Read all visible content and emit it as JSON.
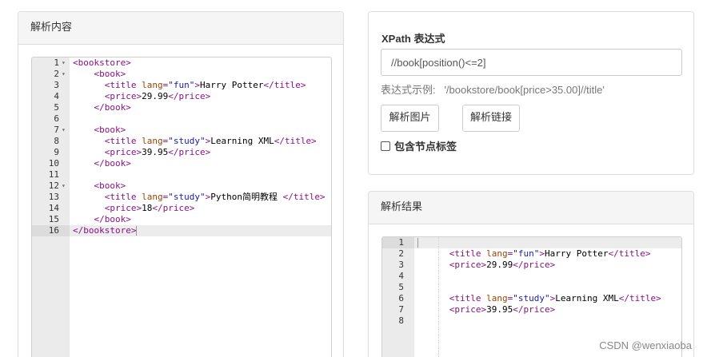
{
  "left_panel": {
    "heading": "解析内容",
    "editor": {
      "active_line": 16,
      "lines": [
        {
          "num": "1",
          "fold": true,
          "parts": [
            [
              "t-tag",
              "<bookstore>"
            ]
          ]
        },
        {
          "num": "2",
          "fold": true,
          "parts": [
            [
              "t-text",
              "    "
            ],
            [
              "t-tag",
              "<book>"
            ]
          ]
        },
        {
          "num": "3",
          "fold": false,
          "parts": [
            [
              "t-text",
              "      "
            ],
            [
              "t-tag",
              "<title "
            ],
            [
              "t-attr",
              "lang"
            ],
            [
              "t-tag",
              "="
            ],
            [
              "t-val",
              "\"fun\""
            ],
            [
              "t-tag",
              ">"
            ],
            [
              "t-text",
              "Harry Potter"
            ],
            [
              "t-tag",
              "</title>"
            ]
          ]
        },
        {
          "num": "4",
          "fold": false,
          "parts": [
            [
              "t-text",
              "      "
            ],
            [
              "t-tag",
              "<price>"
            ],
            [
              "t-text",
              "29.99"
            ],
            [
              "t-tag",
              "</price>"
            ]
          ]
        },
        {
          "num": "5",
          "fold": false,
          "parts": [
            [
              "t-text",
              "    "
            ],
            [
              "t-tag",
              "</book>"
            ]
          ]
        },
        {
          "num": "6",
          "fold": false,
          "parts": []
        },
        {
          "num": "7",
          "fold": true,
          "parts": [
            [
              "t-text",
              "    "
            ],
            [
              "t-tag",
              "<book>"
            ]
          ]
        },
        {
          "num": "8",
          "fold": false,
          "parts": [
            [
              "t-text",
              "      "
            ],
            [
              "t-tag",
              "<title "
            ],
            [
              "t-attr",
              "lang"
            ],
            [
              "t-tag",
              "="
            ],
            [
              "t-val",
              "\"study\""
            ],
            [
              "t-tag",
              ">"
            ],
            [
              "t-text",
              "Learning XML"
            ],
            [
              "t-tag",
              "</title>"
            ]
          ]
        },
        {
          "num": "9",
          "fold": false,
          "parts": [
            [
              "t-text",
              "      "
            ],
            [
              "t-tag",
              "<price>"
            ],
            [
              "t-text",
              "39.95"
            ],
            [
              "t-tag",
              "</price>"
            ]
          ]
        },
        {
          "num": "10",
          "fold": false,
          "parts": [
            [
              "t-text",
              "    "
            ],
            [
              "t-tag",
              "</book>"
            ]
          ]
        },
        {
          "num": "11",
          "fold": false,
          "parts": []
        },
        {
          "num": "12",
          "fold": true,
          "parts": [
            [
              "t-text",
              "    "
            ],
            [
              "t-tag",
              "<book>"
            ]
          ]
        },
        {
          "num": "13",
          "fold": false,
          "parts": [
            [
              "t-text",
              "      "
            ],
            [
              "t-tag",
              "<title "
            ],
            [
              "t-attr",
              "lang"
            ],
            [
              "t-tag",
              "="
            ],
            [
              "t-val",
              "\"study\""
            ],
            [
              "t-tag",
              ">"
            ],
            [
              "t-text",
              "Python简明教程 "
            ],
            [
              "t-tag",
              "</title>"
            ]
          ]
        },
        {
          "num": "14",
          "fold": false,
          "parts": [
            [
              "t-text",
              "      "
            ],
            [
              "t-tag",
              "<price>"
            ],
            [
              "t-text",
              "18"
            ],
            [
              "t-tag",
              "</price>"
            ]
          ]
        },
        {
          "num": "15",
          "fold": false,
          "parts": [
            [
              "t-text",
              "    "
            ],
            [
              "t-tag",
              "</book>"
            ]
          ]
        },
        {
          "num": "16",
          "fold": false,
          "parts": [
            [
              "t-tag",
              "</bookstore>"
            ]
          ]
        }
      ]
    }
  },
  "xpath_panel": {
    "label": "XPath 表达式",
    "input_value": "//book[position()<=2]",
    "example": "表达式示例:   '/bookstore/book[price>35.00]//title'",
    "button_image": "解析图片",
    "button_link": "解析链接",
    "checkbox_label": "包含节点标签",
    "checkbox_checked": false
  },
  "result_panel": {
    "heading": "解析结果",
    "editor": {
      "active_line": 1,
      "lines": [
        {
          "num": "1",
          "parts": []
        },
        {
          "num": "2",
          "parts": [
            [
              "t-text",
              "      "
            ],
            [
              "t-tag",
              "<title "
            ],
            [
              "t-attr",
              "lang"
            ],
            [
              "t-tag",
              "="
            ],
            [
              "t-val",
              "\"fun\""
            ],
            [
              "t-tag",
              ">"
            ],
            [
              "t-text",
              "Harry Potter"
            ],
            [
              "t-tag",
              "</title>"
            ]
          ]
        },
        {
          "num": "3",
          "parts": [
            [
              "t-text",
              "      "
            ],
            [
              "t-tag",
              "<price>"
            ],
            [
              "t-text",
              "29.99"
            ],
            [
              "t-tag",
              "</price>"
            ]
          ]
        },
        {
          "num": "4",
          "parts": []
        },
        {
          "num": "5",
          "parts": []
        },
        {
          "num": "6",
          "parts": [
            [
              "t-text",
              "      "
            ],
            [
              "t-tag",
              "<title "
            ],
            [
              "t-attr",
              "lang"
            ],
            [
              "t-tag",
              "="
            ],
            [
              "t-val",
              "\"study\""
            ],
            [
              "t-tag",
              ">"
            ],
            [
              "t-text",
              "Learning XML"
            ],
            [
              "t-tag",
              "</title>"
            ]
          ]
        },
        {
          "num": "7",
          "parts": [
            [
              "t-text",
              "      "
            ],
            [
              "t-tag",
              "<price>"
            ],
            [
              "t-text",
              "39.95"
            ],
            [
              "t-tag",
              "</price>"
            ]
          ]
        },
        {
          "num": "8",
          "parts": []
        }
      ]
    }
  },
  "watermark": "CSDN @wenxiaoba"
}
